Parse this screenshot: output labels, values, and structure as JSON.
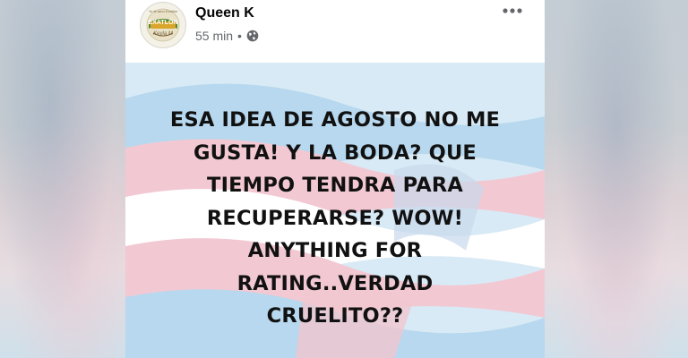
{
  "post": {
    "author": "Queen K",
    "timestamp": "55 min",
    "separator": "•",
    "privacy_icon": "globe-icon",
    "more_icon": "more-options-icon",
    "avatar": {
      "logo_text": "EXATLÓN",
      "small_text_top": "Yo te amo Exatlón",
      "small_text_bottom": "Keyla M"
    },
    "image_text_lines": [
      "ESA IDEA DE AGOSTO NO ME",
      "GUSTA! Y LA BODA? QUE",
      "TIEMPO TENDRA PARA",
      "RECUPERARSE? WOW!",
      "ANYTHING FOR",
      "RATING..VERDAD",
      "CRUELITO??"
    ]
  },
  "colors": {
    "flag_blue": "#a9cfe8",
    "flag_pink": "#f2c9d3",
    "flag_white": "#ffffff",
    "text": "#111111",
    "meta_gray": "#65676b"
  }
}
